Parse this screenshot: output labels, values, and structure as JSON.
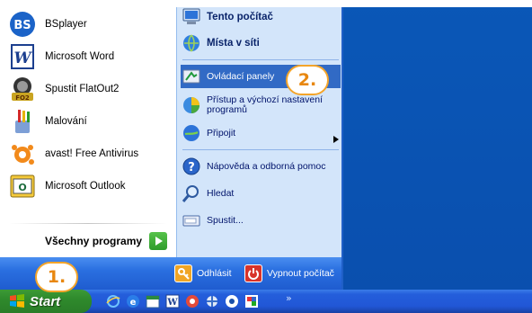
{
  "programs": [
    {
      "label": "BSplayer",
      "icon": "bsplayer-icon"
    },
    {
      "label": "Microsoft Word",
      "icon": "word-icon"
    },
    {
      "label": "Spustit FlatOut2",
      "icon": "flatout-icon"
    },
    {
      "label": "Malování",
      "icon": "paint-icon"
    },
    {
      "label": "avast! Free Antivirus",
      "icon": "avast-icon"
    },
    {
      "label": "Microsoft Outlook",
      "icon": "outlook-icon"
    }
  ],
  "all_programs": "Všechny programy",
  "places": [
    {
      "label": "Tento počítač",
      "icon": "computer-icon"
    },
    {
      "label": "Místa v síti",
      "icon": "network-icon"
    }
  ],
  "system": [
    {
      "label": "Ovládací panely",
      "icon": "control-panel-icon",
      "highlighted": true
    },
    {
      "label": "Přístup a výchozí nastavení programů",
      "icon": "program-access-icon"
    },
    {
      "label": "Připojit",
      "icon": "connect-icon"
    }
  ],
  "help": [
    {
      "label": "Nápověda a odborná pomoc",
      "icon": "help-icon"
    },
    {
      "label": "Hledat",
      "icon": "search-icon"
    },
    {
      "label": "Spustit...",
      "icon": "run-icon"
    }
  ],
  "bottom": {
    "logoff": "Odhlásit",
    "shutdown": "Vypnout počítač"
  },
  "taskbar": {
    "start": "Start",
    "chevron": "»"
  },
  "callouts": {
    "step1": "1.",
    "step2": "2."
  },
  "colors": {
    "highlight": "#316ac5",
    "start_green": "#2f8a2c",
    "callout_orange": "#e8870f"
  }
}
